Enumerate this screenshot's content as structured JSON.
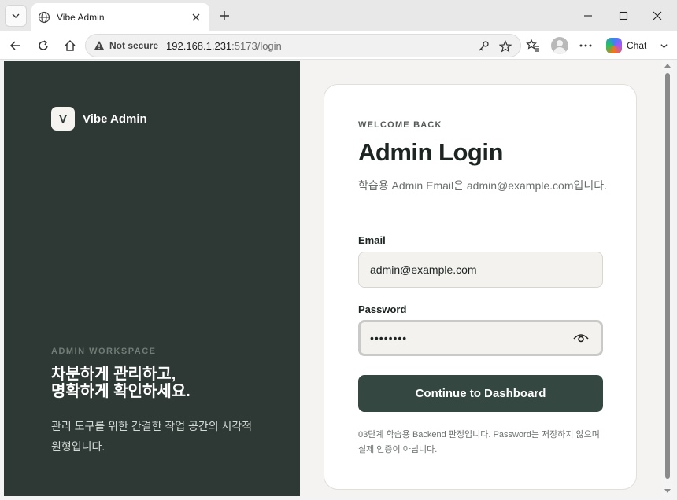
{
  "browser": {
    "tab_title": "Vibe Admin",
    "address": {
      "security_label": "Not secure",
      "url_host": "192.168.1.231",
      "url_rest": ":5173/login"
    },
    "chat_label": "Chat",
    "icons": [
      "tab-list-icon",
      "globe-icon",
      "close-icon",
      "plus-icon",
      "minimize-icon",
      "maximize-icon",
      "back-icon",
      "reload-icon",
      "home-icon",
      "warning-icon",
      "key-icon",
      "star-icon",
      "favorites-icon",
      "profile-avatar",
      "more-icon",
      "copilot-icon",
      "chevron-down-icon"
    ]
  },
  "brand": {
    "logo_letter": "V",
    "name": "Vibe Admin"
  },
  "workspace": {
    "eyebrow": "ADMIN WORKSPACE",
    "headline_line1": "차분하게 관리하고,",
    "headline_line2": "명확하게 확인하세요.",
    "description": "관리 도구를 위한 간결한 작업 공간의 시각적 원형입니다."
  },
  "login": {
    "eyebrow": "WELCOME BACK",
    "title": "Admin Login",
    "subtitle": "학습용 Admin Email은 admin@example.com입니다.",
    "email_label": "Email",
    "email_value": "admin@example.com",
    "password_label": "Password",
    "password_masked": "••••••••",
    "submit_label": "Continue to Dashboard",
    "footnote": "03단계 학습용 Backend 판정입니다. Password는 저장하지 않으며 실제 인증이 아닙니다."
  },
  "colors": {
    "left_panel": "#2e3834",
    "primary_button": "#344740",
    "page_bg": "#f4f3f1"
  }
}
